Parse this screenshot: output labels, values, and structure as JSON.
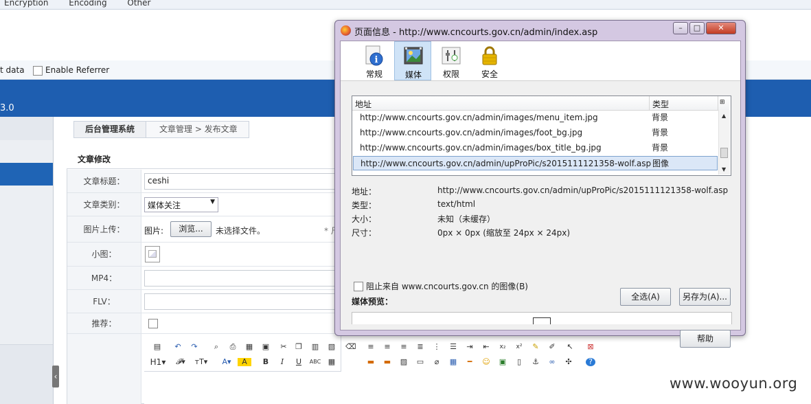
{
  "browser": {
    "menu": [
      "Encryption",
      "Encoding",
      "Other"
    ],
    "toolbar_text": "t data",
    "enable_referrer": "Enable Referrer",
    "version": "3.0"
  },
  "admin": {
    "breadcrumb_home": "后台管理系统",
    "breadcrumb_path": "文章管理 > 发布文章",
    "form_title": "文章修改",
    "fields": {
      "title_label": "文章标题：",
      "title_value": "ceshi",
      "category_label": "文章类别：",
      "category_value": "媒体关注",
      "image_label": "图片上传：",
      "image_prefix": "图片:",
      "browse_label": "浏览...",
      "no_file": "未选择文件。",
      "note": "* 尺",
      "thumb_label": "小图：",
      "mp4_label": "MP4：",
      "flv_label": "FLV：",
      "recommend_label": "推荐："
    },
    "collapse_glyph": "‹"
  },
  "watermark": "www.wooyun.org",
  "dialog": {
    "title": "页面信息 - http://www.cncourts.gov.cn/admin/index.asp",
    "win_min": "–",
    "win_max": "□",
    "win_close": "✕",
    "tabs": [
      {
        "label": "常规",
        "icon": "info-icon"
      },
      {
        "label": "媒体",
        "icon": "media-icon"
      },
      {
        "label": "权限",
        "icon": "permissions-icon"
      },
      {
        "label": "安全",
        "icon": "lock-icon"
      }
    ],
    "list": {
      "col_address": "地址",
      "col_type": "类型",
      "rows": [
        {
          "url": "http://www.cncourts.gov.cn/admin/images/menu_item.jpg",
          "type": "背景"
        },
        {
          "url": "http://www.cncourts.gov.cn/admin/images/foot_bg.jpg",
          "type": "背景"
        },
        {
          "url": "http://www.cncourts.gov.cn/admin/images/box_title_bg.jpg",
          "type": "背景"
        },
        {
          "url": "http://www.cncourts.gov.cn/admin/upProPic/s2015111121358-wolf.asp",
          "type": "图像"
        }
      ]
    },
    "props": {
      "address_label": "地址：",
      "address_value": "http://www.cncourts.gov.cn/admin/upProPic/s2015111121358-wolf.asp",
      "type_label": "类型：",
      "type_value": "text/html",
      "size_label": "大小：",
      "size_value": "未知（未缓存）",
      "dims_label": "尺寸：",
      "dims_value": "0px × 0px (缩放至 24px × 24px)"
    },
    "block_images": "阻止来自 www.cncourts.gov.cn 的图像(B)",
    "media_preview": "媒体预览：",
    "select_all": "全选(A)",
    "save_as": "另存为(A)...",
    "help": "帮助"
  }
}
